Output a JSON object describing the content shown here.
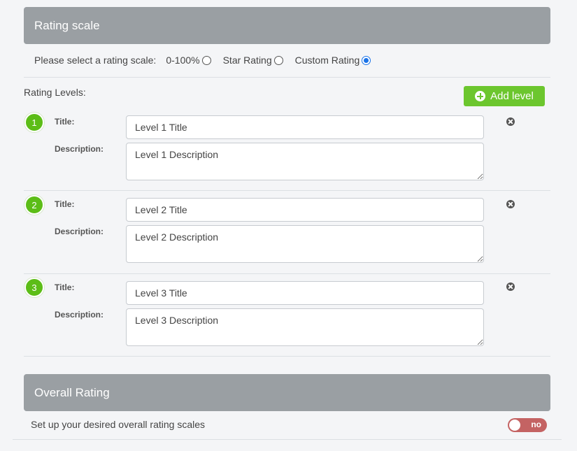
{
  "rating_scale": {
    "header": "Rating scale",
    "prompt": "Please select a rating scale:",
    "options": [
      {
        "label": "0-100%",
        "selected": false
      },
      {
        "label": "Star Rating",
        "selected": false
      },
      {
        "label": "Custom Rating",
        "selected": true
      }
    ]
  },
  "levels": {
    "label": "Rating Levels:",
    "add_button": "Add level",
    "title_label": "Title:",
    "description_label": "Description:",
    "items": [
      {
        "number": "1",
        "title": "Level 1 Title",
        "description": "Level 1 Description"
      },
      {
        "number": "2",
        "title": "Level 2 Title",
        "description": "Level 2 Description"
      },
      {
        "number": "3",
        "title": "Level 3 Title",
        "description": "Level 3 Description"
      }
    ]
  },
  "overall": {
    "header": "Overall Rating",
    "text": "Set up your desired overall rating scales",
    "toggle_label": "no",
    "enabled": false
  },
  "colors": {
    "header_bg": "#9a9fa3",
    "accent_green": "#6cc62e",
    "toggle_off": "#c46363",
    "radio_selected": "#1a73e8"
  }
}
